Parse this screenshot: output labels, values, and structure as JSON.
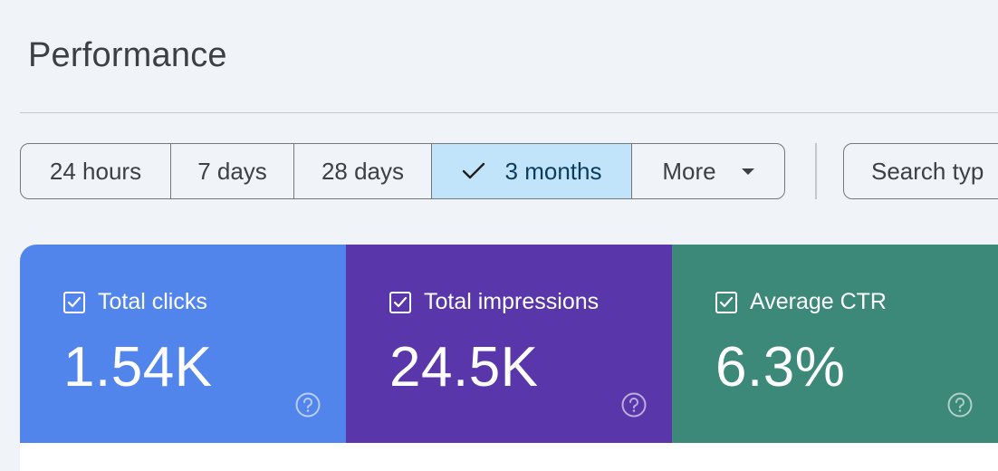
{
  "header": {
    "title": "Performance"
  },
  "date_range": {
    "options": [
      {
        "label": "24 hours",
        "selected": false
      },
      {
        "label": "7 days",
        "selected": false
      },
      {
        "label": "28 days",
        "selected": false
      },
      {
        "label": "3 months",
        "selected": true
      },
      {
        "label": "More",
        "selected": false
      }
    ]
  },
  "filters": {
    "search_type_label": "Search typ"
  },
  "metrics": [
    {
      "label": "Total clicks",
      "value": "1.54K",
      "color": "#5285ec",
      "checked": true
    },
    {
      "label": "Total impressions",
      "value": "24.5K",
      "color": "#5936aa",
      "checked": true
    },
    {
      "label": "Average CTR",
      "value": "6.3%",
      "color": "#3c8879",
      "checked": true
    }
  ],
  "icons": {
    "selected_check": "check-icon",
    "more_caret": "caret-down-icon",
    "help": "help-icon",
    "checkbox": "checkbox-checked-icon"
  }
}
